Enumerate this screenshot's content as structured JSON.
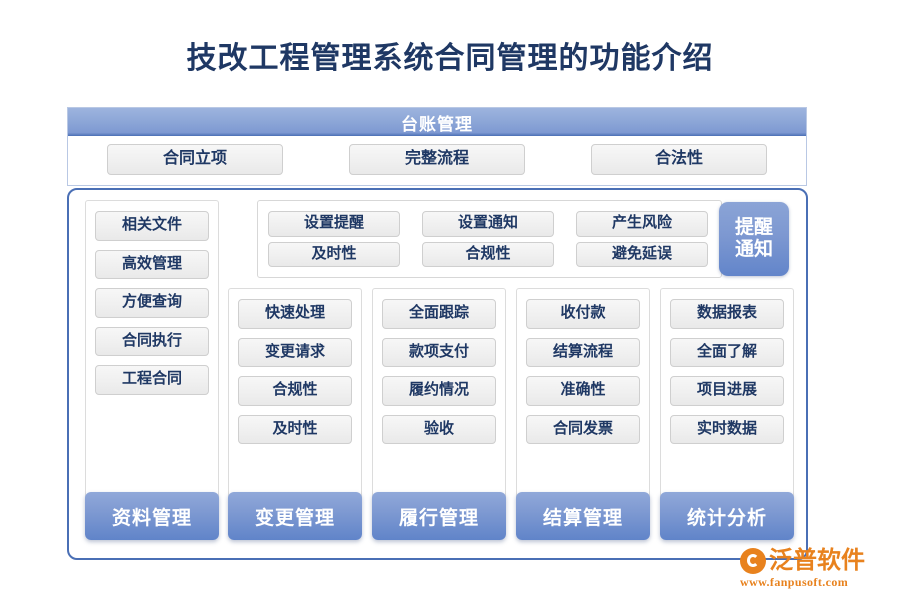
{
  "page": {
    "title": "技改工程管理系统合同管理的功能介绍",
    "title_color": "#1f3864"
  },
  "ledger": {
    "header_label": "台账管理",
    "header_color": "#8aa4d6",
    "buttons": [
      {
        "label": "合同立项"
      },
      {
        "label": "完整流程"
      },
      {
        "label": "合法性"
      }
    ]
  },
  "reminder": {
    "badge_line1": "提醒",
    "badge_line2": "通知",
    "badge_color": "#7d98d1",
    "row1": [
      {
        "label": "设置提醒"
      },
      {
        "label": "设置通知"
      },
      {
        "label": "产生风险"
      }
    ],
    "row2": [
      {
        "label": "及时性"
      },
      {
        "label": "合规性"
      },
      {
        "label": "避免延误"
      }
    ]
  },
  "columns": [
    {
      "footer_label": "资料管理",
      "items": [
        {
          "label": "相关文件"
        },
        {
          "label": "高效管理"
        },
        {
          "label": "方便查询"
        },
        {
          "label": "合同执行"
        },
        {
          "label": "工程合同"
        }
      ]
    },
    {
      "footer_label": "变更管理",
      "items": [
        {
          "label": "快速处理"
        },
        {
          "label": "变更请求"
        },
        {
          "label": "合规性"
        },
        {
          "label": "及时性"
        }
      ]
    },
    {
      "footer_label": "履行管理",
      "items": [
        {
          "label": "全面跟踪"
        },
        {
          "label": "款项支付"
        },
        {
          "label": "履约情况"
        },
        {
          "label": "验收"
        }
      ]
    },
    {
      "footer_label": "结算管理",
      "items": [
        {
          "label": "收付款"
        },
        {
          "label": "结算流程"
        },
        {
          "label": "准确性"
        },
        {
          "label": "合同发票"
        }
      ]
    },
    {
      "footer_label": "统计分析",
      "items": [
        {
          "label": "数据报表"
        },
        {
          "label": "全面了解"
        },
        {
          "label": "项目进展"
        },
        {
          "label": "实时数据"
        }
      ]
    }
  ],
  "logo": {
    "name": "泛普软件",
    "url": "www.fanpusoft.com",
    "color": "#e8821e"
  }
}
